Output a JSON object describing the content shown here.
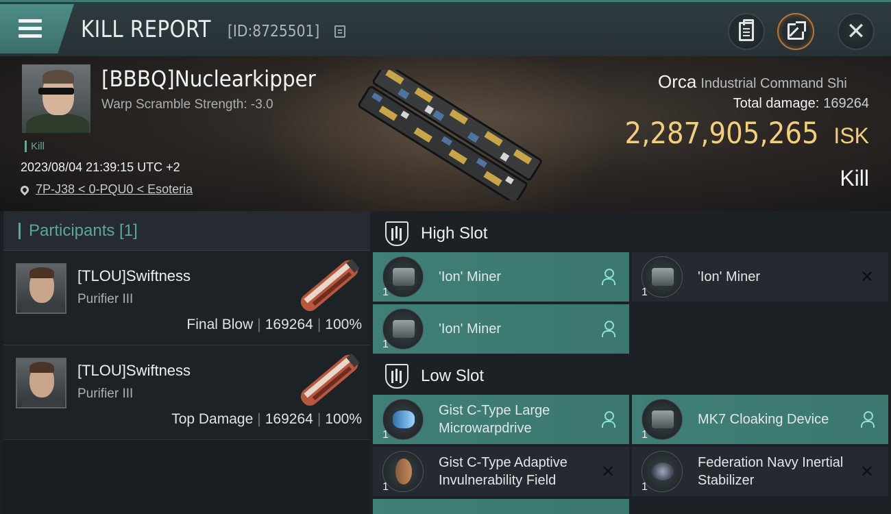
{
  "header": {
    "title": "KILL REPORT",
    "report_id": "[ID:8725501]",
    "icons": [
      "menu-icon",
      "copy-icon",
      "clipboard-icon",
      "share-icon",
      "close-icon"
    ]
  },
  "victim": {
    "name": "[BBBQ]Nuclearkipper",
    "warp_scramble": "Warp Scramble Strength: -3.0",
    "tag": "Kill",
    "datetime": "2023/08/04 21:39:15 UTC +2",
    "location": "7P-J38 < 0-PQU0 < Esoteria",
    "ship_name": "Orca",
    "ship_class": "Industrial Command Shi",
    "total_damage_label": "Total damage:",
    "total_damage": "169264",
    "isk_value": "2,287,905,265",
    "isk_unit": "ISK",
    "result": "Kill"
  },
  "participants": {
    "title": "Participants [1]",
    "rows": [
      {
        "name": "[TLOU]Swiftness",
        "ship": "Purifier III",
        "role": "Final Blow",
        "damage": "169264",
        "percent": "100%"
      },
      {
        "name": "[TLOU]Swiftness",
        "ship": "Purifier III",
        "role": "Top Damage",
        "damage": "169264",
        "percent": "100%"
      }
    ]
  },
  "fitting": {
    "high_slot_title": "High Slot",
    "low_slot_title": "Low Slot",
    "high_modules": [
      {
        "name": "'Ion' Miner",
        "qty": "1",
        "status": "dropped"
      },
      {
        "name": "'Ion' Miner",
        "qty": "1",
        "status": "destroyed"
      },
      {
        "name": "'Ion' Miner",
        "qty": "1",
        "status": "dropped"
      }
    ],
    "low_modules": [
      {
        "name": "Gist C-Type Large Microwarpdrive",
        "qty": "1",
        "status": "dropped"
      },
      {
        "name": "MK7 Cloaking Device",
        "qty": "1",
        "status": "dropped"
      },
      {
        "name": "Gist C-Type Adaptive Invulnerability Field",
        "qty": "1",
        "status": "destroyed"
      },
      {
        "name": "Federation Navy Inertial Stabilizer",
        "qty": "1",
        "status": "destroyed"
      }
    ]
  },
  "colors": {
    "accent_teal": "#5aa79c",
    "isk_gold": "#f3cf7d",
    "module_active": "#3f7f77"
  }
}
